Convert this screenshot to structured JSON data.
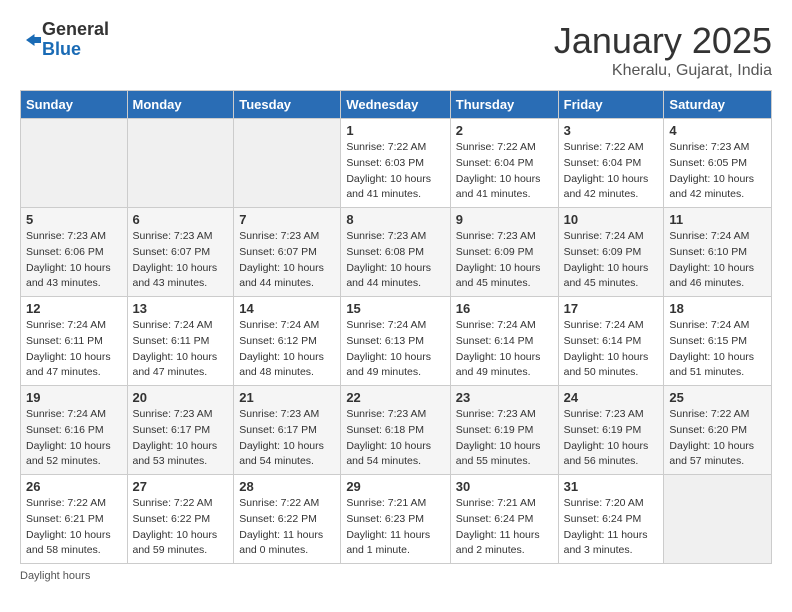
{
  "logo": {
    "general": "General",
    "blue": "Blue"
  },
  "title": "January 2025",
  "location": "Kheralu, Gujarat, India",
  "days_of_week": [
    "Sunday",
    "Monday",
    "Tuesday",
    "Wednesday",
    "Thursday",
    "Friday",
    "Saturday"
  ],
  "weeks": [
    [
      {
        "day": "",
        "info": ""
      },
      {
        "day": "",
        "info": ""
      },
      {
        "day": "",
        "info": ""
      },
      {
        "day": "1",
        "info": "Sunrise: 7:22 AM\nSunset: 6:03 PM\nDaylight: 10 hours\nand 41 minutes."
      },
      {
        "day": "2",
        "info": "Sunrise: 7:22 AM\nSunset: 6:04 PM\nDaylight: 10 hours\nand 41 minutes."
      },
      {
        "day": "3",
        "info": "Sunrise: 7:22 AM\nSunset: 6:04 PM\nDaylight: 10 hours\nand 42 minutes."
      },
      {
        "day": "4",
        "info": "Sunrise: 7:23 AM\nSunset: 6:05 PM\nDaylight: 10 hours\nand 42 minutes."
      }
    ],
    [
      {
        "day": "5",
        "info": "Sunrise: 7:23 AM\nSunset: 6:06 PM\nDaylight: 10 hours\nand 43 minutes."
      },
      {
        "day": "6",
        "info": "Sunrise: 7:23 AM\nSunset: 6:07 PM\nDaylight: 10 hours\nand 43 minutes."
      },
      {
        "day": "7",
        "info": "Sunrise: 7:23 AM\nSunset: 6:07 PM\nDaylight: 10 hours\nand 44 minutes."
      },
      {
        "day": "8",
        "info": "Sunrise: 7:23 AM\nSunset: 6:08 PM\nDaylight: 10 hours\nand 44 minutes."
      },
      {
        "day": "9",
        "info": "Sunrise: 7:23 AM\nSunset: 6:09 PM\nDaylight: 10 hours\nand 45 minutes."
      },
      {
        "day": "10",
        "info": "Sunrise: 7:24 AM\nSunset: 6:09 PM\nDaylight: 10 hours\nand 45 minutes."
      },
      {
        "day": "11",
        "info": "Sunrise: 7:24 AM\nSunset: 6:10 PM\nDaylight: 10 hours\nand 46 minutes."
      }
    ],
    [
      {
        "day": "12",
        "info": "Sunrise: 7:24 AM\nSunset: 6:11 PM\nDaylight: 10 hours\nand 47 minutes."
      },
      {
        "day": "13",
        "info": "Sunrise: 7:24 AM\nSunset: 6:11 PM\nDaylight: 10 hours\nand 47 minutes."
      },
      {
        "day": "14",
        "info": "Sunrise: 7:24 AM\nSunset: 6:12 PM\nDaylight: 10 hours\nand 48 minutes."
      },
      {
        "day": "15",
        "info": "Sunrise: 7:24 AM\nSunset: 6:13 PM\nDaylight: 10 hours\nand 49 minutes."
      },
      {
        "day": "16",
        "info": "Sunrise: 7:24 AM\nSunset: 6:14 PM\nDaylight: 10 hours\nand 49 minutes."
      },
      {
        "day": "17",
        "info": "Sunrise: 7:24 AM\nSunset: 6:14 PM\nDaylight: 10 hours\nand 50 minutes."
      },
      {
        "day": "18",
        "info": "Sunrise: 7:24 AM\nSunset: 6:15 PM\nDaylight: 10 hours\nand 51 minutes."
      }
    ],
    [
      {
        "day": "19",
        "info": "Sunrise: 7:24 AM\nSunset: 6:16 PM\nDaylight: 10 hours\nand 52 minutes."
      },
      {
        "day": "20",
        "info": "Sunrise: 7:23 AM\nSunset: 6:17 PM\nDaylight: 10 hours\nand 53 minutes."
      },
      {
        "day": "21",
        "info": "Sunrise: 7:23 AM\nSunset: 6:17 PM\nDaylight: 10 hours\nand 54 minutes."
      },
      {
        "day": "22",
        "info": "Sunrise: 7:23 AM\nSunset: 6:18 PM\nDaylight: 10 hours\nand 54 minutes."
      },
      {
        "day": "23",
        "info": "Sunrise: 7:23 AM\nSunset: 6:19 PM\nDaylight: 10 hours\nand 55 minutes."
      },
      {
        "day": "24",
        "info": "Sunrise: 7:23 AM\nSunset: 6:19 PM\nDaylight: 10 hours\nand 56 minutes."
      },
      {
        "day": "25",
        "info": "Sunrise: 7:22 AM\nSunset: 6:20 PM\nDaylight: 10 hours\nand 57 minutes."
      }
    ],
    [
      {
        "day": "26",
        "info": "Sunrise: 7:22 AM\nSunset: 6:21 PM\nDaylight: 10 hours\nand 58 minutes."
      },
      {
        "day": "27",
        "info": "Sunrise: 7:22 AM\nSunset: 6:22 PM\nDaylight: 10 hours\nand 59 minutes."
      },
      {
        "day": "28",
        "info": "Sunrise: 7:22 AM\nSunset: 6:22 PM\nDaylight: 11 hours\nand 0 minutes."
      },
      {
        "day": "29",
        "info": "Sunrise: 7:21 AM\nSunset: 6:23 PM\nDaylight: 11 hours\nand 1 minute."
      },
      {
        "day": "30",
        "info": "Sunrise: 7:21 AM\nSunset: 6:24 PM\nDaylight: 11 hours\nand 2 minutes."
      },
      {
        "day": "31",
        "info": "Sunrise: 7:20 AM\nSunset: 6:24 PM\nDaylight: 11 hours\nand 3 minutes."
      },
      {
        "day": "",
        "info": ""
      }
    ]
  ],
  "footer": "Daylight hours"
}
